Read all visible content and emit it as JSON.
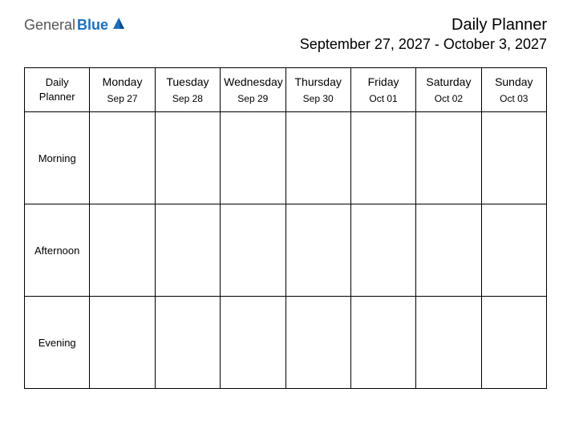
{
  "brand": {
    "part1": "General",
    "part2": "Blue"
  },
  "header": {
    "title": "Daily Planner",
    "subtitle": "September 27, 2027 - October 3, 2027"
  },
  "table": {
    "corner": "Daily Planner",
    "days": [
      {
        "name": "Monday",
        "date": "Sep 27"
      },
      {
        "name": "Tuesday",
        "date": "Sep 28"
      },
      {
        "name": "Wednesday",
        "date": "Sep 29"
      },
      {
        "name": "Thursday",
        "date": "Sep 30"
      },
      {
        "name": "Friday",
        "date": "Oct 01"
      },
      {
        "name": "Saturday",
        "date": "Oct 02"
      },
      {
        "name": "Sunday",
        "date": "Oct 03"
      }
    ],
    "periods": [
      "Morning",
      "Afternoon",
      "Evening"
    ]
  }
}
